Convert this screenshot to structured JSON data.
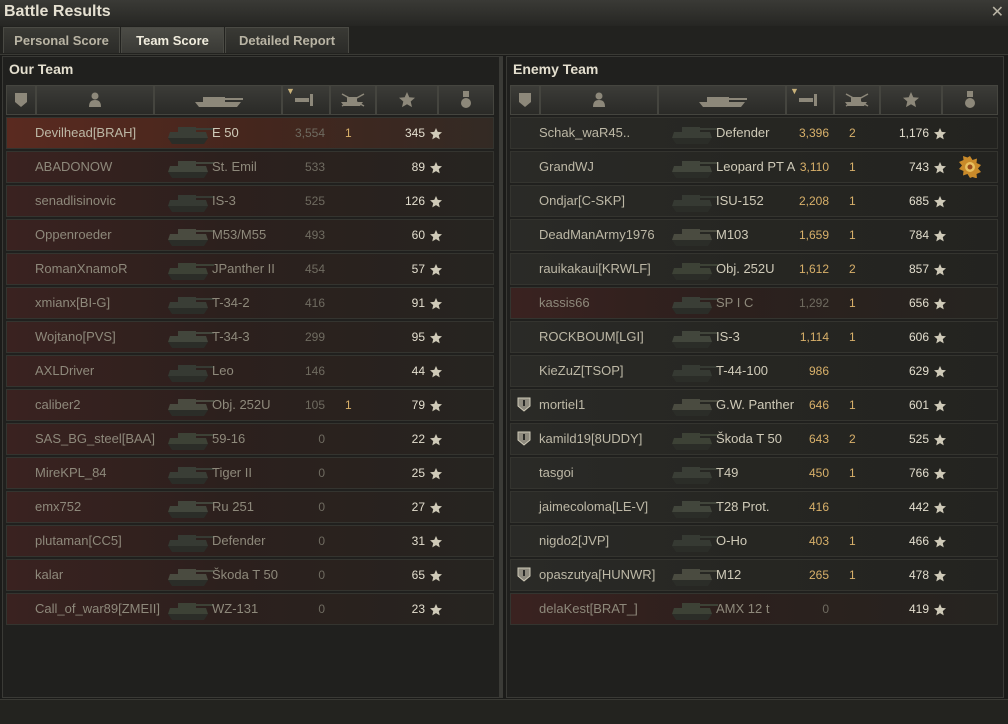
{
  "window": {
    "title": "Battle Results",
    "close_glyph": "✕"
  },
  "tabs": [
    {
      "label": "Personal Score",
      "active": false
    },
    {
      "label": "Team Score",
      "active": true
    },
    {
      "label": "Detailed Report",
      "active": false
    }
  ],
  "teams": [
    {
      "title": "Our Team",
      "headers": [
        "platoon-icon",
        "player-icon",
        "tank-icon",
        "damage-icon",
        "kills-icon",
        "xp-star-icon",
        "medal-icon"
      ],
      "players": [
        {
          "name": "Devilhead[BRAH]",
          "tank": "E 50",
          "damage": "3,554",
          "kills": "1",
          "xp": "345",
          "dead": false,
          "self": true,
          "platoon": false,
          "medal": false
        },
        {
          "name": "ABADONOW",
          "tank": "St. Emil",
          "damage": "533",
          "kills": "",
          "xp": "89",
          "dead": true,
          "self": false,
          "platoon": false,
          "medal": false
        },
        {
          "name": "senadlisinovic",
          "tank": "IS-3",
          "damage": "525",
          "kills": "",
          "xp": "126",
          "dead": true,
          "self": false,
          "platoon": false,
          "medal": false
        },
        {
          "name": "Oppenroeder",
          "tank": "M53/M55",
          "damage": "493",
          "kills": "",
          "xp": "60",
          "dead": true,
          "self": false,
          "platoon": false,
          "medal": false
        },
        {
          "name": "RomanXnamoR",
          "tank": "JPanther II",
          "damage": "454",
          "kills": "",
          "xp": "57",
          "dead": true,
          "self": false,
          "platoon": false,
          "medal": false
        },
        {
          "name": "xmianx[BI-G]",
          "tank": "T-34-2",
          "damage": "416",
          "kills": "",
          "xp": "91",
          "dead": true,
          "self": false,
          "platoon": false,
          "medal": false
        },
        {
          "name": "Wojtano[PVS]",
          "tank": "T-34-3",
          "damage": "299",
          "kills": "",
          "xp": "95",
          "dead": true,
          "self": false,
          "platoon": false,
          "medal": false
        },
        {
          "name": "AXLDriver",
          "tank": "Leo",
          "damage": "146",
          "kills": "",
          "xp": "44",
          "dead": true,
          "self": false,
          "platoon": false,
          "medal": false
        },
        {
          "name": "caliber2",
          "tank": "Obj. 252U",
          "damage": "105",
          "kills": "1",
          "xp": "79",
          "dead": true,
          "self": false,
          "platoon": false,
          "medal": false
        },
        {
          "name": "SAS_BG_steel[BAA]",
          "tank": "59-16",
          "damage": "0",
          "kills": "",
          "xp": "22",
          "dead": true,
          "self": false,
          "platoon": false,
          "medal": false
        },
        {
          "name": "MireKPL_84",
          "tank": "Tiger II",
          "damage": "0",
          "kills": "",
          "xp": "25",
          "dead": true,
          "self": false,
          "platoon": false,
          "medal": false
        },
        {
          "name": "emx752",
          "tank": "Ru 251",
          "damage": "0",
          "kills": "",
          "xp": "27",
          "dead": true,
          "self": false,
          "platoon": false,
          "medal": false
        },
        {
          "name": "plutaman[CC5]",
          "tank": "Defender",
          "damage": "0",
          "kills": "",
          "xp": "31",
          "dead": true,
          "self": false,
          "platoon": false,
          "medal": false
        },
        {
          "name": "kalar",
          "tank": "Škoda T 50",
          "damage": "0",
          "kills": "",
          "xp": "65",
          "dead": true,
          "self": false,
          "platoon": false,
          "medal": false
        },
        {
          "name": "Call_of_war89[ZMEII]",
          "tank": "WZ-131",
          "damage": "0",
          "kills": "",
          "xp": "23",
          "dead": true,
          "self": false,
          "platoon": false,
          "medal": false
        }
      ]
    },
    {
      "title": "Enemy Team",
      "headers": [
        "platoon-icon",
        "player-icon",
        "tank-icon",
        "damage-icon",
        "kills-icon",
        "xp-star-icon",
        "medal-icon"
      ],
      "players": [
        {
          "name": "Schak_waR45..",
          "tank": "Defender",
          "damage": "3,396",
          "kills": "2",
          "xp": "1,176",
          "dead": false,
          "self": false,
          "platoon": false,
          "medal": false
        },
        {
          "name": "GrandWJ",
          "tank": "Leopard PT A",
          "damage": "3,110",
          "kills": "1",
          "xp": "743",
          "dead": false,
          "self": false,
          "platoon": false,
          "medal": true
        },
        {
          "name": "Ondjar[C-SKP]",
          "tank": "ISU-152",
          "damage": "2,208",
          "kills": "1",
          "xp": "685",
          "dead": false,
          "self": false,
          "platoon": false,
          "medal": false
        },
        {
          "name": "DeadManArmy1976",
          "tank": "M103",
          "damage": "1,659",
          "kills": "1",
          "xp": "784",
          "dead": false,
          "self": false,
          "platoon": false,
          "medal": false
        },
        {
          "name": "rauikakaui[KRWLF]",
          "tank": "Obj. 252U",
          "damage": "1,612",
          "kills": "2",
          "xp": "857",
          "dead": false,
          "self": false,
          "platoon": false,
          "medal": false
        },
        {
          "name": "kassis66",
          "tank": "SP I C",
          "damage": "1,292",
          "kills": "1",
          "xp": "656",
          "dead": true,
          "self": false,
          "platoon": false,
          "medal": false
        },
        {
          "name": "ROCKBOUM[LGI]",
          "tank": "IS-3",
          "damage": "1,114",
          "kills": "1",
          "xp": "606",
          "dead": false,
          "self": false,
          "platoon": false,
          "medal": false
        },
        {
          "name": "KieZuZ[TSOP]",
          "tank": "T-44-100",
          "damage": "986",
          "kills": "",
          "xp": "629",
          "dead": false,
          "self": false,
          "platoon": false,
          "medal": false
        },
        {
          "name": "mortiel1",
          "tank": "G.W. Panther",
          "damage": "646",
          "kills": "1",
          "xp": "601",
          "dead": false,
          "self": false,
          "platoon": true,
          "medal": false
        },
        {
          "name": "kamild19[8UDDY]",
          "tank": "Škoda T 50",
          "damage": "643",
          "kills": "2",
          "xp": "525",
          "dead": false,
          "self": false,
          "platoon": true,
          "medal": false
        },
        {
          "name": "tasgoi",
          "tank": "T49",
          "damage": "450",
          "kills": "1",
          "xp": "766",
          "dead": false,
          "self": false,
          "platoon": false,
          "medal": false
        },
        {
          "name": "jaimecoloma[LE-V]",
          "tank": "T28 Prot.",
          "damage": "416",
          "kills": "",
          "xp": "442",
          "dead": false,
          "self": false,
          "platoon": false,
          "medal": false
        },
        {
          "name": "nigdo2[JVP]",
          "tank": "O-Ho",
          "damage": "403",
          "kills": "1",
          "xp": "466",
          "dead": false,
          "self": false,
          "platoon": false,
          "medal": false
        },
        {
          "name": "opaszutya[HUNWR]",
          "tank": "M12",
          "damage": "265",
          "kills": "1",
          "xp": "478",
          "dead": false,
          "self": false,
          "platoon": true,
          "medal": false
        },
        {
          "name": "delaKest[BRAT_]",
          "tank": "AMX 12 t",
          "damage": "0",
          "kills": "",
          "xp": "419",
          "dead": true,
          "self": false,
          "platoon": false,
          "medal": false
        }
      ]
    }
  ],
  "colors": {
    "damage": "#d8b06a",
    "dead_row": "#3a2220",
    "self_row": "#5a2a20"
  }
}
